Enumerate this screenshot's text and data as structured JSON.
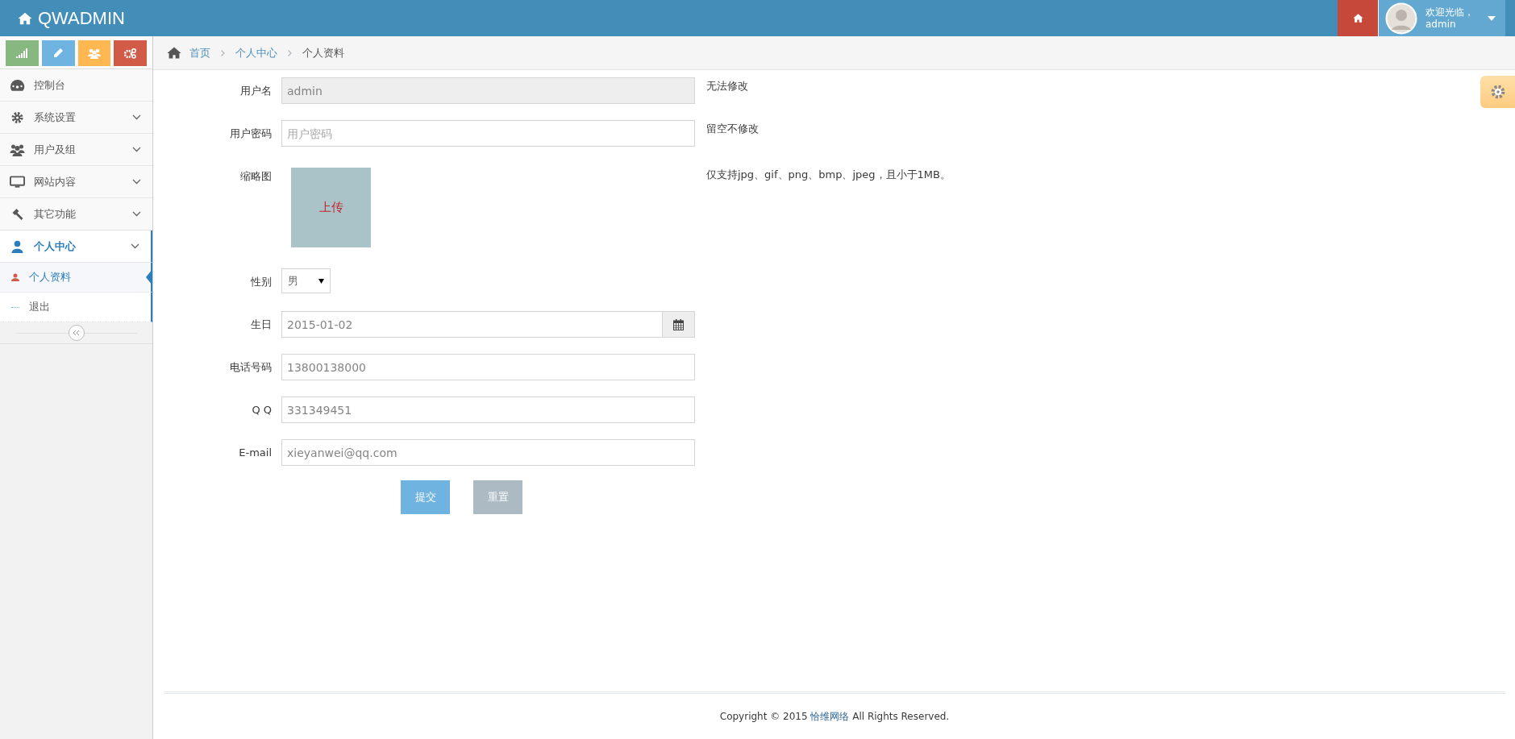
{
  "header": {
    "brand": "QWADMIN",
    "greeting": "欢迎光临，",
    "username": "admin"
  },
  "shortcuts": [
    {
      "kind": "signal",
      "color": "#87b87f"
    },
    {
      "kind": "pencil",
      "color": "#6fb3e0"
    },
    {
      "kind": "users",
      "color": "#ffb752"
    },
    {
      "kind": "cogs",
      "color": "#d15b47"
    }
  ],
  "menu": [
    {
      "label": "控制台",
      "kind": "dashboard",
      "selected": false
    },
    {
      "label": "系统设置",
      "kind": "cog",
      "selected": false
    },
    {
      "label": "用户及组",
      "kind": "users",
      "selected": false
    },
    {
      "label": "网站内容",
      "kind": "desktop",
      "selected": false
    },
    {
      "label": "其它功能",
      "kind": "gavel",
      "selected": false
    },
    {
      "label": "个人中心",
      "kind": "user",
      "selected": true,
      "children": [
        {
          "label": "个人资料",
          "selected": true
        },
        {
          "label": "退出",
          "selected": false
        }
      ]
    }
  ],
  "breadcrumb": [
    "首页",
    "个人中心",
    "个人资料"
  ],
  "form": {
    "fields": [
      {
        "kind": "text",
        "label": "用户名",
        "value": "admin",
        "disabled": true,
        "help": "无法修改"
      },
      {
        "kind": "password",
        "label": "用户密码",
        "placeholder": "用户密码",
        "disabled": false,
        "help": "留空不修改"
      },
      {
        "kind": "image",
        "label": "缩略图",
        "overlay": "上传",
        "help": "仅支持jpg、gif、png、bmp、jpeg，且小于1MB。"
      },
      {
        "kind": "select",
        "label": "性别",
        "value": "男"
      },
      {
        "kind": "date",
        "label": "生日",
        "value": "2015-01-02"
      },
      {
        "kind": "text",
        "label": "电话号码",
        "value": "13800138000",
        "disabled": false
      },
      {
        "kind": "text",
        "label": "Q  Q",
        "value": "331349451",
        "disabled": false
      },
      {
        "kind": "text",
        "label": "E-mail",
        "value": "xieyanwei@qq.com",
        "disabled": false
      }
    ],
    "buttons": [
      {
        "label": "提交",
        "kind": "primary"
      },
      {
        "label": "重置",
        "kind": "secondary"
      }
    ]
  },
  "footer": {
    "prefix": "Copyright © 2015",
    "link": "恰维网络",
    "suffix": "All Rights Reserved."
  }
}
